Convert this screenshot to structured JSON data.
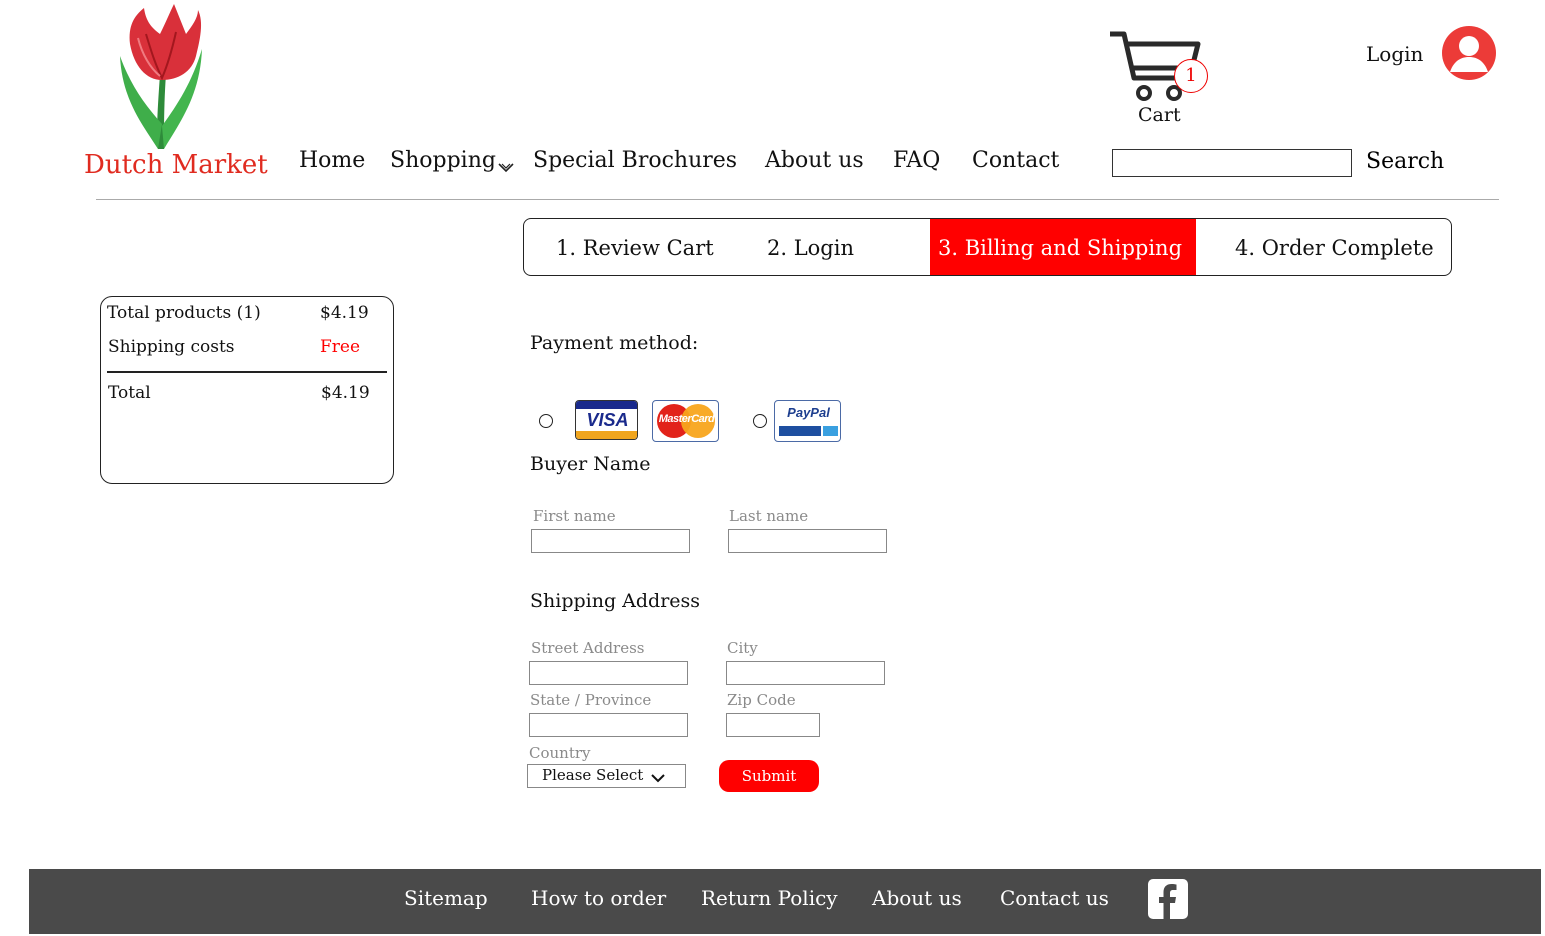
{
  "brand": {
    "name": "Dutch Market",
    "logo_icon": "tulip-icon",
    "accent_color": "#e02b20"
  },
  "nav": {
    "items": [
      {
        "label": "Home"
      },
      {
        "label": "Shopping",
        "has_dropdown": true
      },
      {
        "label": "Special Brochures"
      },
      {
        "label": "About us"
      },
      {
        "label": "FAQ"
      },
      {
        "label": "Contact"
      }
    ]
  },
  "header": {
    "cart": {
      "label": "Cart",
      "count": "1",
      "icon": "cart-icon"
    },
    "login": {
      "label": "Login",
      "icon": "user-avatar-icon"
    },
    "search": {
      "value": "",
      "button_label": "Search"
    }
  },
  "steps": [
    {
      "label": "1. Review Cart",
      "active": false
    },
    {
      "label": "2. Login",
      "active": false
    },
    {
      "label": "3. Billing and Shipping",
      "active": true
    },
    {
      "label": "4. Order Complete",
      "active": false
    }
  ],
  "summary": {
    "total_products_label": "Total products (1)",
    "total_products_value": "$4.19",
    "shipping_label": "Shipping costs",
    "shipping_value": "Free",
    "total_label": "Total",
    "total_value": "$4.19"
  },
  "payment": {
    "title": "Payment method:",
    "options": [
      {
        "cards": [
          "VISA",
          "MasterCard"
        ]
      },
      {
        "cards": [
          "PayPal"
        ]
      }
    ]
  },
  "buyer": {
    "title": "Buyer Name",
    "first_name_label": "First name",
    "last_name_label": "Last name"
  },
  "shipping": {
    "title": "Shipping Address",
    "street_label": "Street Address",
    "city_label": "City",
    "state_label": "State / Province",
    "zip_label": "Zip Code",
    "country_label": "Country",
    "country_value": "Please Select"
  },
  "submit_label": "Submit",
  "footer": {
    "links": [
      "Sitemap",
      "How to order",
      "Return Policy",
      "About us",
      "Contact us"
    ],
    "social_icon": "facebook-icon",
    "background": "#4a4a4a"
  }
}
